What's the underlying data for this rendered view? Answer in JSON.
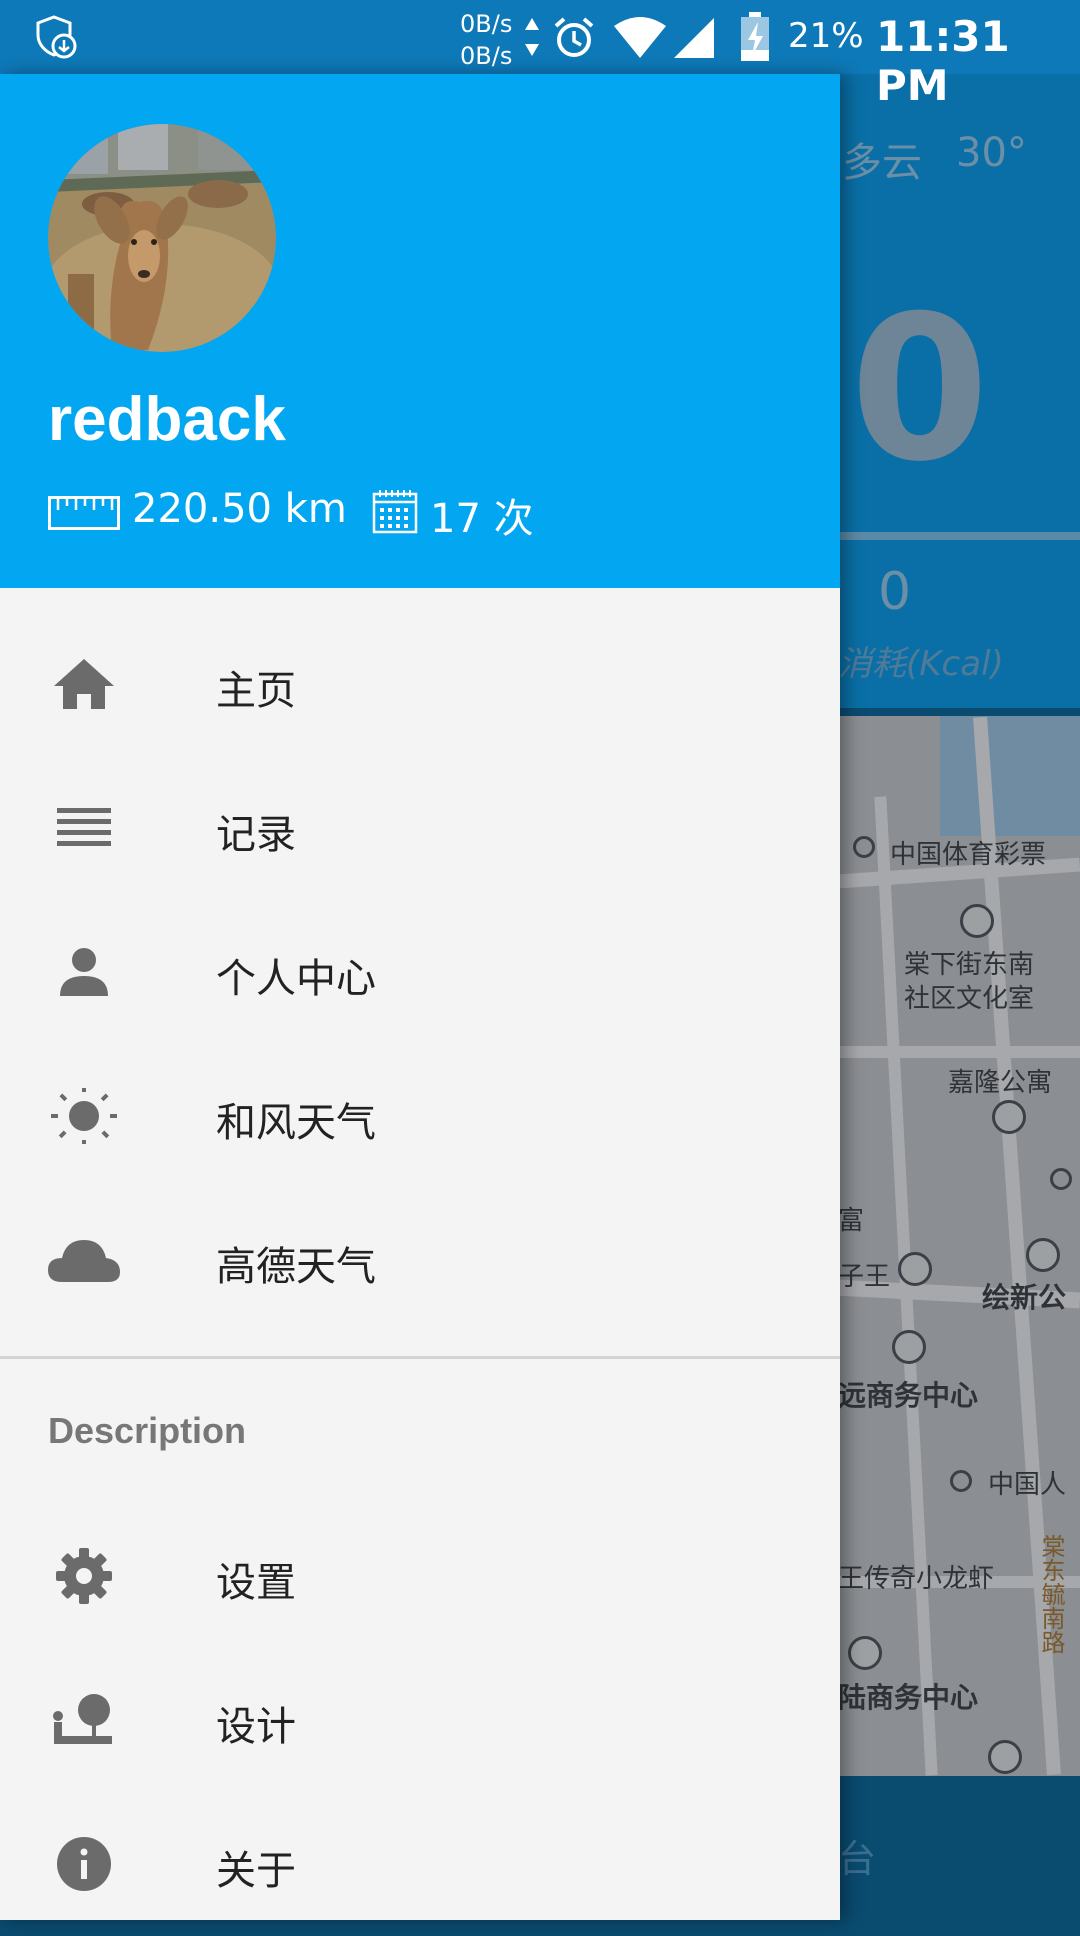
{
  "status_bar": {
    "net_up": "0B/s",
    "net_down": "0B/s",
    "battery_percent": "21%",
    "time": "11:31 PM"
  },
  "background_app": {
    "weather": "多云",
    "temperature": "30°",
    "steps": "0",
    "kcal_value": "0",
    "kcal_label": "消耗(Kcal)",
    "bottom_text": "台",
    "map_labels": [
      "中国体育彩票",
      "棠下街东南",
      "社区文化室",
      "嘉隆公寓",
      "富",
      "子王",
      "绘新公",
      "远商务中心",
      "中国人",
      "王传奇小龙虾",
      "棠东毓南路",
      "陆商务中心"
    ]
  },
  "drawer": {
    "header": {
      "username": "redback",
      "distance": "220.50 km",
      "count": "17 次",
      "background_color": "#03a7f1"
    },
    "menu": [
      {
        "label": "主页",
        "icon": "home-icon"
      },
      {
        "label": "记录",
        "icon": "list-icon"
      },
      {
        "label": "个人中心",
        "icon": "person-icon"
      },
      {
        "label": "和风天气",
        "icon": "sun-icon"
      },
      {
        "label": "高德天气",
        "icon": "cloud-icon"
      }
    ],
    "section_title": "Description",
    "section_menu": [
      {
        "label": "设置",
        "icon": "gear-icon"
      },
      {
        "label": "设计",
        "icon": "design-icon"
      },
      {
        "label": "关于",
        "icon": "info-icon"
      }
    ]
  },
  "colors": {
    "accent": "#03a7f1",
    "status_bar": "#0e79b8",
    "drawer_bg": "#f4f4f4",
    "icon_gray": "#6b6b6b"
  }
}
